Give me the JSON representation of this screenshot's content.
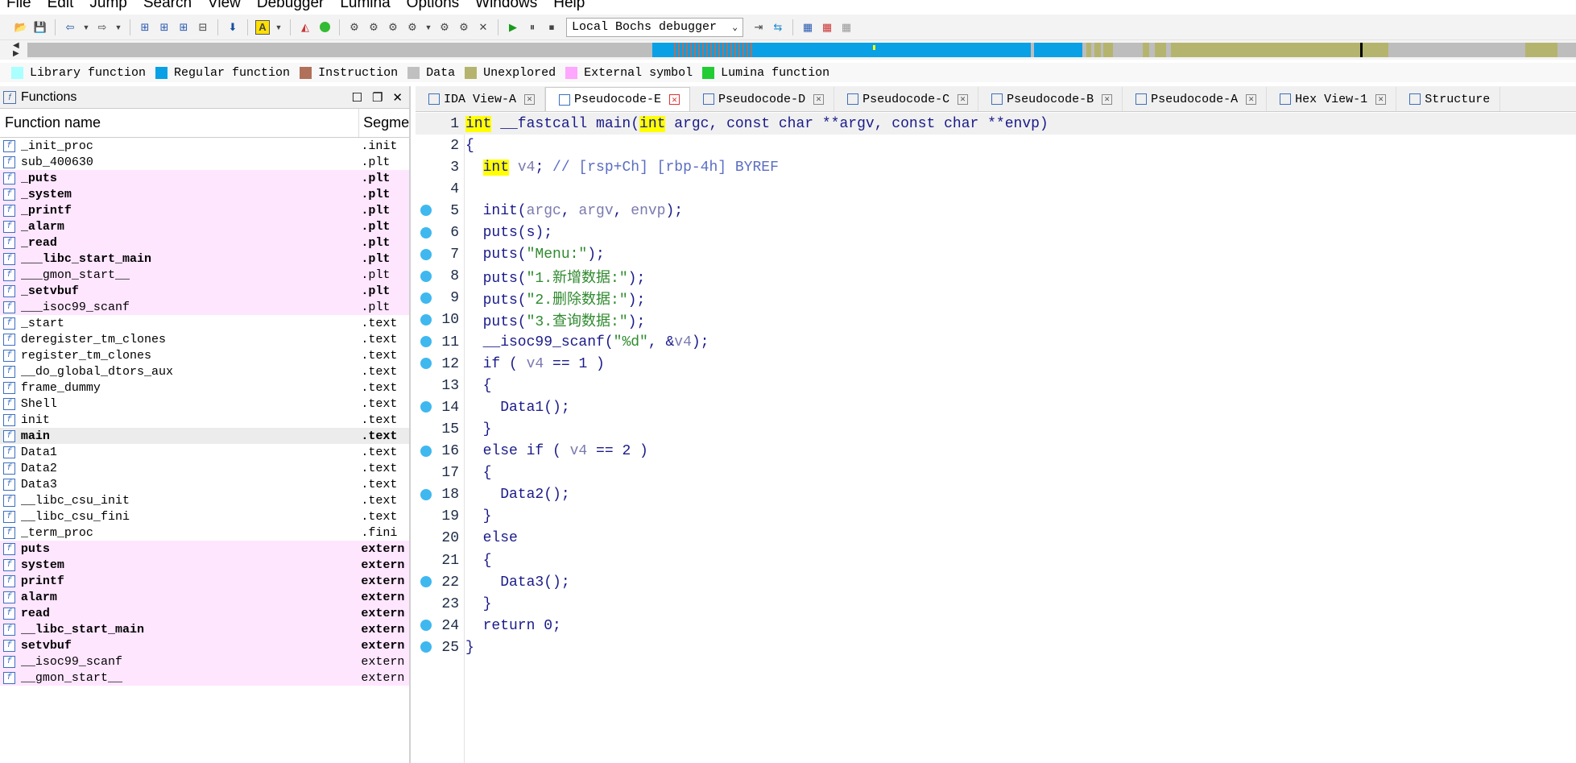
{
  "menu": [
    "File",
    "Edit",
    "Jump",
    "Search",
    "View",
    "Debugger",
    "Lumina",
    "Options",
    "Windows",
    "Help"
  ],
  "toolbar": {
    "debugger_select": "Local Bochs debugger"
  },
  "legend": [
    {
      "label": "Library function",
      "color": "#aaffff"
    },
    {
      "label": "Regular function",
      "color": "#0aa0e6"
    },
    {
      "label": "Instruction",
      "color": "#b0705a"
    },
    {
      "label": "Data",
      "color": "#c0c0c0"
    },
    {
      "label": "Unexplored",
      "color": "#b4b46e"
    },
    {
      "label": "External symbol",
      "color": "#ffa6ff"
    },
    {
      "label": "Lumina function",
      "color": "#22cc33"
    }
  ],
  "functions_panel": {
    "title": "Functions",
    "col_name": "Function name",
    "col_segment": "Segme",
    "rows": [
      {
        "name": "_init_proc",
        "seg": ".init",
        "style": "normal"
      },
      {
        "name": "sub_400630",
        "seg": ".plt",
        "style": "normal"
      },
      {
        "name": "_puts",
        "seg": ".plt",
        "style": "pinkbold"
      },
      {
        "name": "_system",
        "seg": ".plt",
        "style": "pinkbold"
      },
      {
        "name": "_printf",
        "seg": ".plt",
        "style": "pinkbold"
      },
      {
        "name": "_alarm",
        "seg": ".plt",
        "style": "pinkbold"
      },
      {
        "name": "_read",
        "seg": ".plt",
        "style": "pinkbold"
      },
      {
        "name": "___libc_start_main",
        "seg": ".plt",
        "style": "pinkbold"
      },
      {
        "name": "___gmon_start__",
        "seg": ".plt",
        "style": "pink"
      },
      {
        "name": "_setvbuf",
        "seg": ".plt",
        "style": "pinkbold"
      },
      {
        "name": "___isoc99_scanf",
        "seg": ".plt",
        "style": "pink"
      },
      {
        "name": "_start",
        "seg": ".text",
        "style": "normal"
      },
      {
        "name": "deregister_tm_clones",
        "seg": ".text",
        "style": "normal"
      },
      {
        "name": "register_tm_clones",
        "seg": ".text",
        "style": "normal"
      },
      {
        "name": "__do_global_dtors_aux",
        "seg": ".text",
        "style": "normal"
      },
      {
        "name": "frame_dummy",
        "seg": ".text",
        "style": "normal"
      },
      {
        "name": "Shell",
        "seg": ".text",
        "style": "normal"
      },
      {
        "name": "init",
        "seg": ".text",
        "style": "normal"
      },
      {
        "name": "main",
        "seg": ".text",
        "style": "selbold"
      },
      {
        "name": "Data1",
        "seg": ".text",
        "style": "normal"
      },
      {
        "name": "Data2",
        "seg": ".text",
        "style": "normal"
      },
      {
        "name": "Data3",
        "seg": ".text",
        "style": "normal"
      },
      {
        "name": "__libc_csu_init",
        "seg": ".text",
        "style": "normal"
      },
      {
        "name": "__libc_csu_fini",
        "seg": ".text",
        "style": "normal"
      },
      {
        "name": "_term_proc",
        "seg": ".fini",
        "style": "normal"
      },
      {
        "name": "puts",
        "seg": "extern",
        "style": "pinkbold"
      },
      {
        "name": "system",
        "seg": "extern",
        "style": "pinkbold"
      },
      {
        "name": "printf",
        "seg": "extern",
        "style": "pinkbold"
      },
      {
        "name": "alarm",
        "seg": "extern",
        "style": "pinkbold"
      },
      {
        "name": "read",
        "seg": "extern",
        "style": "pinkbold"
      },
      {
        "name": "__libc_start_main",
        "seg": "extern",
        "style": "pinkbold"
      },
      {
        "name": "setvbuf",
        "seg": "extern",
        "style": "pinkbold"
      },
      {
        "name": "__isoc99_scanf",
        "seg": "extern",
        "style": "pink"
      },
      {
        "name": "__gmon_start__",
        "seg": "extern",
        "style": "pink"
      }
    ]
  },
  "tabs": [
    {
      "label": "IDA View-A",
      "active": false
    },
    {
      "label": "Pseudocode-E",
      "active": true
    },
    {
      "label": "Pseudocode-D",
      "active": false
    },
    {
      "label": "Pseudocode-C",
      "active": false
    },
    {
      "label": "Pseudocode-B",
      "active": false
    },
    {
      "label": "Pseudocode-A",
      "active": false
    },
    {
      "label": "Hex View-1",
      "active": false
    },
    {
      "label": "Structure",
      "active": false
    }
  ],
  "code_lines": [
    {
      "n": "1",
      "bp": false,
      "parts": [
        [
          "kw",
          "int"
        ],
        [
          "t",
          " __fastcall main("
        ],
        [
          "kw",
          "int"
        ],
        [
          "t",
          " argc, const char **argv, const char **envp)"
        ]
      ]
    },
    {
      "n": "2",
      "bp": false,
      "parts": [
        [
          "t",
          "{"
        ]
      ]
    },
    {
      "n": "3",
      "bp": false,
      "parts": [
        [
          "t",
          "  "
        ],
        [
          "kw",
          "int"
        ],
        [
          "t",
          " "
        ],
        [
          "v",
          "v4"
        ],
        [
          "t",
          "; "
        ],
        [
          "c",
          "// [rsp+Ch] [rbp-4h] BYREF"
        ]
      ]
    },
    {
      "n": "4",
      "bp": false,
      "parts": []
    },
    {
      "n": "5",
      "bp": true,
      "parts": [
        [
          "t",
          "  init("
        ],
        [
          "v",
          "argc"
        ],
        [
          "t",
          ", "
        ],
        [
          "v",
          "argv"
        ],
        [
          "t",
          ", "
        ],
        [
          "v",
          "envp"
        ],
        [
          "t",
          ");"
        ]
      ]
    },
    {
      "n": "6",
      "bp": true,
      "parts": [
        [
          "t",
          "  puts(s);"
        ]
      ]
    },
    {
      "n": "7",
      "bp": true,
      "parts": [
        [
          "t",
          "  puts("
        ],
        [
          "s",
          "\"Menu:\""
        ],
        [
          "t",
          ");"
        ]
      ]
    },
    {
      "n": "8",
      "bp": true,
      "parts": [
        [
          "t",
          "  puts("
        ],
        [
          "s",
          "\"1.新增数据:\""
        ],
        [
          "t",
          ");"
        ]
      ]
    },
    {
      "n": "9",
      "bp": true,
      "parts": [
        [
          "t",
          "  puts("
        ],
        [
          "s",
          "\"2.删除数据:\""
        ],
        [
          "t",
          ");"
        ]
      ]
    },
    {
      "n": "10",
      "bp": true,
      "parts": [
        [
          "t",
          "  puts("
        ],
        [
          "s",
          "\"3.查询数据:\""
        ],
        [
          "t",
          ");"
        ]
      ]
    },
    {
      "n": "11",
      "bp": true,
      "parts": [
        [
          "t",
          "  __isoc99_scanf("
        ],
        [
          "s",
          "\"%d\""
        ],
        [
          "t",
          ", &"
        ],
        [
          "v",
          "v4"
        ],
        [
          "t",
          ");"
        ]
      ]
    },
    {
      "n": "12",
      "bp": true,
      "parts": [
        [
          "t",
          "  if ( "
        ],
        [
          "v",
          "v4"
        ],
        [
          "t",
          " == 1 )"
        ]
      ]
    },
    {
      "n": "13",
      "bp": false,
      "parts": [
        [
          "t",
          "  {"
        ]
      ]
    },
    {
      "n": "14",
      "bp": true,
      "parts": [
        [
          "t",
          "    Data1();"
        ]
      ]
    },
    {
      "n": "15",
      "bp": false,
      "parts": [
        [
          "t",
          "  }"
        ]
      ]
    },
    {
      "n": "16",
      "bp": true,
      "parts": [
        [
          "t",
          "  else if ( "
        ],
        [
          "v",
          "v4"
        ],
        [
          "t",
          " == 2 )"
        ]
      ]
    },
    {
      "n": "17",
      "bp": false,
      "parts": [
        [
          "t",
          "  {"
        ]
      ]
    },
    {
      "n": "18",
      "bp": true,
      "parts": [
        [
          "t",
          "    Data2();"
        ]
      ]
    },
    {
      "n": "19",
      "bp": false,
      "parts": [
        [
          "t",
          "  }"
        ]
      ]
    },
    {
      "n": "20",
      "bp": false,
      "parts": [
        [
          "t",
          "  else"
        ]
      ]
    },
    {
      "n": "21",
      "bp": false,
      "parts": [
        [
          "t",
          "  {"
        ]
      ]
    },
    {
      "n": "22",
      "bp": true,
      "parts": [
        [
          "t",
          "    Data3();"
        ]
      ]
    },
    {
      "n": "23",
      "bp": false,
      "parts": [
        [
          "t",
          "  }"
        ]
      ]
    },
    {
      "n": "24",
      "bp": true,
      "parts": [
        [
          "t",
          "  return 0;"
        ]
      ]
    },
    {
      "n": "25",
      "bp": true,
      "parts": [
        [
          "t",
          "}"
        ]
      ]
    }
  ]
}
